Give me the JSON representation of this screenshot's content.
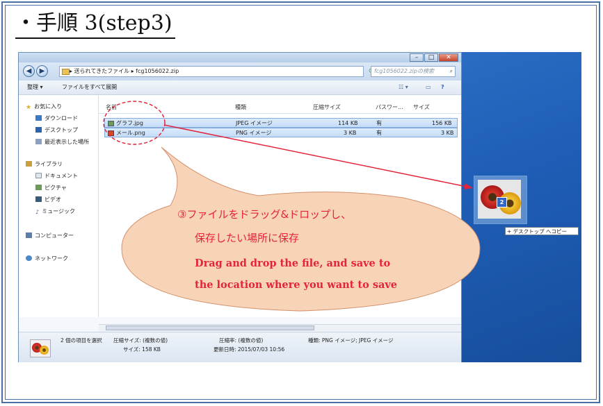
{
  "heading": "・手順 3(step3)",
  "explorer": {
    "window_buttons": {
      "minimize": "–",
      "maximize": "□",
      "close": "✕"
    },
    "nav": {
      "back": "◀",
      "forward": "▶"
    },
    "address_path": "▸ 送られてきたファイル ▸ fcg1056022.zip",
    "search_placeholder": "fcg1056022.zipの検索",
    "toolbar": {
      "organize": "整理 ▾",
      "extract_all": "ファイルをすべて展開"
    },
    "sidebar": {
      "favorites": "お気に入り",
      "downloads": "ダウンロード",
      "desktop": "デスクトップ",
      "recent": "最近表示した場所",
      "libraries": "ライブラリ",
      "documents": "ドキュメント",
      "pictures": "ピクチャ",
      "videos": "ビデオ",
      "music": "ミュージック",
      "computer": "コンピューター",
      "network": "ネットワーク"
    },
    "columns": {
      "name": "名前",
      "type": "種類",
      "compressed_size": "圧縮サイズ",
      "password": "パスワー...",
      "size": "サイズ"
    },
    "files": [
      {
        "name": "グラフ.jpg",
        "type": "JPEG イメージ",
        "compressed": "114 KB",
        "password": "有",
        "size": "156 KB"
      },
      {
        "name": "メール.png",
        "type": "PNG イメージ",
        "compressed": "3 KB",
        "password": "有",
        "size": "3 KB"
      }
    ],
    "details": {
      "selection": "2 個の項目を選択",
      "compressed_size": "圧縮サイズ: (複数の値)",
      "size": "サイズ: 158 KB",
      "ratio": "圧縮率: (複数の値)",
      "modified": "更新日時: 2015/07/03 10:56",
      "kind": "種類: PNG イメージ; JPEG イメージ"
    }
  },
  "drag": {
    "count": "2",
    "tooltip": "+ デスクトップ へコピー"
  },
  "callout": {
    "jp_line1": "③ファイルをドラッグ&ドロップし、",
    "jp_line2": "保存したい場所に保存",
    "en_line1": "Drag and drop the file, and save to",
    "en_line2": "the location where you want to save"
  },
  "colors": {
    "accent_red": "#e4243a",
    "callout_fill": "#f7d3b8",
    "desktop_blue": "#1f5fb8"
  }
}
